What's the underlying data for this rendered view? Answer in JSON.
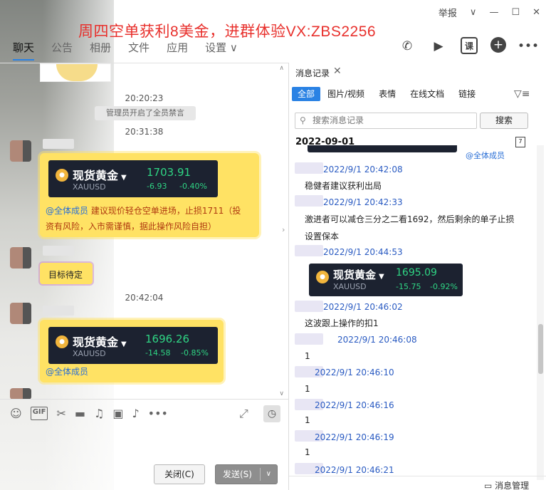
{
  "window": {
    "report_label": "举报",
    "ad_text": "周四空单获利8美金，进群体验VX:ZBS2256"
  },
  "tabs": [
    {
      "label": "聊天",
      "active": true
    },
    {
      "label": "公告",
      "active": false
    },
    {
      "label": "相册",
      "active": false
    },
    {
      "label": "文件",
      "active": false
    },
    {
      "label": "应用",
      "active": false
    },
    {
      "label": "设置 ∨",
      "active": false
    }
  ],
  "toolbar_icons": [
    "phone-icon",
    "video-icon",
    "class-icon",
    "add-icon",
    "more-icon"
  ],
  "toolbar_class_label": "课",
  "chat": {
    "time1": "20:20:23",
    "system_notice": "管理员开启了全员禁言",
    "time2": "20:31:38",
    "card1": {
      "title": "现货黄金",
      "symbol": "XAUUSD",
      "price": "1703.91",
      "change": "-6.93",
      "pct": "-0.40%"
    },
    "msg1_mention": "@全体成员",
    "msg1_line1": " 建议现价轻仓空单进场，止损1711（投",
    "msg1_line2": "资有风险，入市需谨慎，据此操作风险自担）",
    "msg2": "目标待定",
    "time3": "20:42:04",
    "card2": {
      "title": "现货黄金",
      "symbol": "XAUUSD",
      "price": "1696.26",
      "change": "-14.58",
      "pct": "-0.85%"
    },
    "msg3_mention": "@全体成员"
  },
  "input": {
    "close_label": "关闭(C)",
    "send_label": "发送(S)"
  },
  "history": {
    "tab_label": "消息记录",
    "filters": [
      "全部",
      "图片/视频",
      "表情",
      "在线文档",
      "链接"
    ],
    "search_placeholder": "搜索消息记录",
    "search_button": "搜索",
    "date": "2022-09-01",
    "partial_mention": "@全体成员",
    "entries": [
      {
        "time": "2022/9/1 20:42:08",
        "text": "稳健者建议获利出局"
      },
      {
        "time": "2022/9/1 20:42:33",
        "text": "激进者可以减仓三分之二看1692，然后剩余的单子止损",
        "text2": "设置保本"
      },
      {
        "time": "2022/9/1 20:44:53"
      },
      {
        "time": "2022/9/1 20:46:02",
        "text": "这波跟上操作的扣1"
      },
      {
        "time": "2022/9/1 20:46:08",
        "text": "1"
      },
      {
        "time": "2022/9/1 20:46:10",
        "text": "1"
      },
      {
        "time": "2022/9/1 20:46:16",
        "text": "1"
      },
      {
        "time": "2022/9/1 20:46:19",
        "text": "1"
      },
      {
        "time": "2022/9/1 20:46:21"
      }
    ],
    "card3": {
      "title": "现货黄金",
      "symbol": "XAUUSD",
      "price": "1695.09",
      "change": "-15.75",
      "pct": "-0.92%"
    },
    "bottom_label": "消息管理"
  }
}
